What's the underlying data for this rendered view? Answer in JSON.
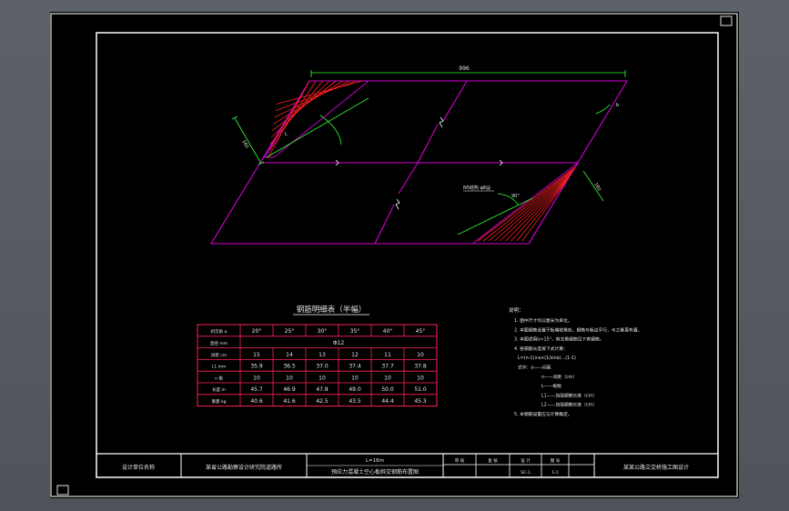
{
  "drawing": {
    "dim_overall": "996",
    "dim_skew_top": "b",
    "dim_left_a": "160",
    "dim_left_b": "L",
    "dim_right_a": "160",
    "dim_right_b": "90°",
    "callout": "N5结构 φ8@",
    "line_color": "#d400d4",
    "hatch_color": "#ff2020",
    "dim_color": "#33ff33"
  },
  "table": {
    "title": "钢筋明细表（半幅）",
    "headers": [
      "斜交角 α",
      "20°",
      "25°",
      "30°",
      "35°",
      "40°",
      "45°"
    ],
    "rows": [
      {
        "label": "直径 mm",
        "merged": "Φ12"
      },
      {
        "label": "间距 cm",
        "values": [
          "15",
          "14",
          "13",
          "12",
          "11",
          "10"
        ]
      },
      {
        "label": "L1 mm",
        "values": [
          "35.9",
          "36.5",
          "37.0",
          "37.4",
          "37.7",
          "37.8"
        ]
      },
      {
        "label": "n 根",
        "values": [
          "10",
          "10",
          "10",
          "10",
          "10",
          "10"
        ]
      },
      {
        "label": "长度 m",
        "values": [
          "45.7",
          "46.9",
          "47.8",
          "49.0",
          "50.0",
          "51.0"
        ]
      },
      {
        "label": "重量 kg",
        "values": [
          "40.6",
          "41.6",
          "42.5",
          "43.5",
          "44.4",
          "45.3"
        ]
      }
    ],
    "line_color": "#ff2255"
  },
  "notes": {
    "heading": "说明：",
    "lines": [
      "1. 图中尺寸均以厘米为单位。",
      "2. 本图钢筋设置于板端锐角处，钢筋与板边平行，与之垂直布置。",
      "3. 本图适用α>15°，斜交角钢筋见下表钢筋。",
      "4. 各钢筋长度按下式计算：",
      "L=(n-1)×a×(1/sinα)...(1-1)",
      "式中：a——间距",
      "n——间距（cm）",
      "L——根数",
      "L1——加强钢筋长度（cm）",
      "L2——加强钢筋长度（cm）",
      "5. 本钢筋设置应与计算确定。"
    ]
  },
  "title_block": {
    "col1": "设计单位名称",
    "col2": "某省公路勘察设计研究院道路所",
    "drawing_no": "L=16m",
    "drawing_title": "预应力混凝土空心板斜交钢筋布置图",
    "sheet_headers": [
      "审 核",
      "复 核",
      "设 计",
      "图 号"
    ],
    "sheet_values": [
      "",
      "",
      "SC-1",
      "1-1"
    ],
    "right_text": "某某公路立交桥施工图设计"
  }
}
